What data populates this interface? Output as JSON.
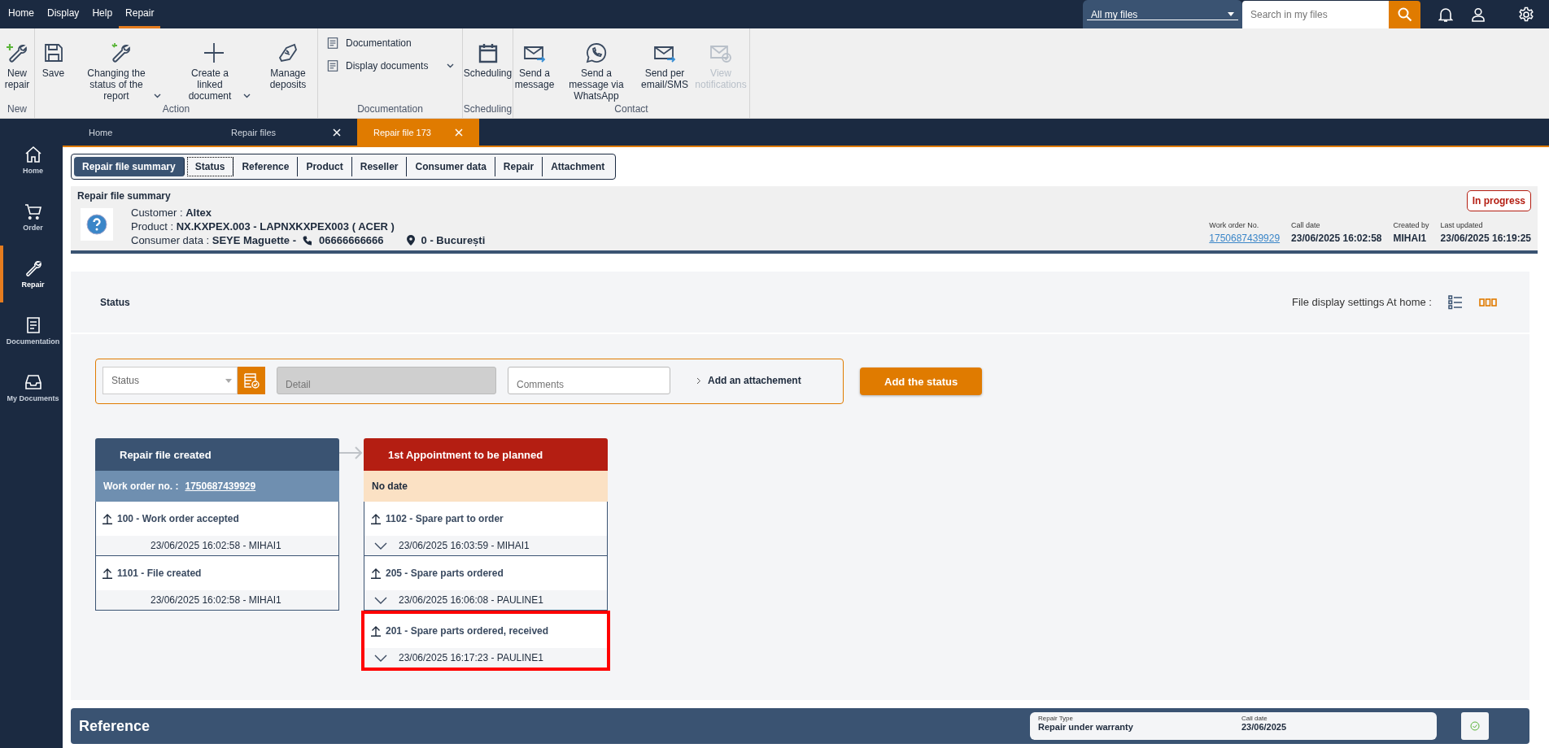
{
  "menu": [
    {
      "label": "Home",
      "selected": false
    },
    {
      "label": "Display",
      "selected": false
    },
    {
      "label": "Help",
      "selected": false
    },
    {
      "label": "Repair",
      "selected": true
    }
  ],
  "scope_select": {
    "value": "All my files"
  },
  "search": {
    "placeholder": "Search in my files"
  },
  "ribbon": [
    {
      "name": "New",
      "items": [
        {
          "label": "New repair",
          "dropdown": false,
          "disabled": false
        }
      ]
    },
    {
      "name": "Action",
      "items": [
        {
          "label": "Save",
          "dropdown": false,
          "disabled": false
        },
        {
          "label": "Changing the status of the report",
          "dropdown": true,
          "disabled": false
        },
        {
          "label": "Create a linked document",
          "dropdown": true,
          "disabled": false
        },
        {
          "label": "Manage deposits",
          "dropdown": false,
          "disabled": false
        }
      ]
    },
    {
      "name": "Documentation",
      "items": [
        {
          "label": "Documentation",
          "dropdown": false,
          "disabled": false
        },
        {
          "label": "Display documents",
          "dropdown": true,
          "disabled": false
        }
      ]
    },
    {
      "name": "Scheduling",
      "items": [
        {
          "label": "Scheduling",
          "dropdown": false,
          "disabled": false
        }
      ]
    },
    {
      "name": "Contact",
      "items": [
        {
          "label": "Send a message",
          "dropdown": false,
          "disabled": false
        },
        {
          "label": "Send a message via WhatsApp",
          "dropdown": false,
          "disabled": false
        },
        {
          "label": "Send per email/SMS",
          "dropdown": false,
          "disabled": false
        },
        {
          "label": "View notifications",
          "dropdown": false,
          "disabled": true
        }
      ]
    }
  ],
  "sidebar": [
    {
      "label": "Home",
      "selected": false
    },
    {
      "label": "Order",
      "selected": false
    },
    {
      "label": "Repair",
      "selected": true
    },
    {
      "label": "Documentation",
      "selected": false
    },
    {
      "label": "My Documents",
      "selected": false
    }
  ],
  "doc_tabs": [
    {
      "label": "Home",
      "closable": false,
      "selected": false
    },
    {
      "label": "Repair files",
      "closable": true,
      "selected": false
    },
    {
      "label": "Repair file 173",
      "closable": true,
      "selected": true
    }
  ],
  "section_tabs": [
    {
      "label": "Repair file summary",
      "selected": true,
      "focused": false
    },
    {
      "label": "Status",
      "selected": false,
      "focused": true
    },
    {
      "label": "Reference",
      "selected": false,
      "focused": false
    },
    {
      "label": "Product",
      "selected": false,
      "focused": false
    },
    {
      "label": "Reseller",
      "selected": false,
      "focused": false
    },
    {
      "label": "Consumer data",
      "selected": false,
      "focused": false
    },
    {
      "label": "Repair",
      "selected": false,
      "focused": false
    },
    {
      "label": "Attachment",
      "selected": false,
      "focused": false
    }
  ],
  "summary": {
    "title": "Repair file summary",
    "customer": "Customer : **Altex**",
    "product": "Product : **NX.KXPEX.003  -  LAPNXKXPEX003 ( ACER )**",
    "consumer": "Consumer data : **SEYE Maguette -**",
    "phone": "06666666666",
    "location": "0  -  București",
    "badge": "In progress",
    "meta": [
      {
        "label": "Work order No.",
        "value": "1750687439929",
        "kind": "link"
      },
      {
        "label": "Call date",
        "value": "23/06/2025 16:02:58",
        "kind": "text"
      },
      {
        "label": "Created by",
        "value": "MIHAI1",
        "kind": "text"
      },
      {
        "label": "Last updated",
        "value": "23/06/2025 16:19:25",
        "kind": "text"
      }
    ]
  },
  "status_panel": {
    "title": "Status",
    "display_settings": "File display settings At home :",
    "views": [
      {
        "selected": false
      },
      {
        "selected": true
      }
    ]
  },
  "form": {
    "status_placeholder": "Status",
    "detail_placeholder": "Detail",
    "comments_placeholder": "Comments",
    "attachment": "Add an attachement",
    "button": "Add the status"
  },
  "timeline": [
    {
      "title": "Repair file created",
      "color": "#3a5372",
      "sub_label": "Work order no. :",
      "sub_value": "1750687439929",
      "entries": [
        {
          "title": "100 - Work order accepted",
          "meta": "23/06/2025 16:02:58  -  MIHAI1",
          "expandable": false,
          "highlighted": false
        },
        {
          "title": "1101 - File created",
          "meta": "23/06/2025 16:02:58  -  MIHAI1",
          "expandable": false,
          "highlighted": false
        }
      ]
    },
    {
      "title": "1st Appointment to be planned",
      "color": "#b41e12",
      "sub_label": "No date",
      "entries": [
        {
          "title": "1102 - Spare part to order",
          "meta": "23/06/2025 16:03:59  -  MIHAI1",
          "expandable": true,
          "highlighted": false
        },
        {
          "title": "205 - Spare parts ordered",
          "meta": "23/06/2025 16:06:08  -  PAULINE1",
          "expandable": true,
          "highlighted": false
        },
        {
          "title": "201 - Spare parts ordered, received",
          "meta": "23/06/2025 16:17:23  -  PAULINE1",
          "expandable": true,
          "highlighted": true
        }
      ]
    }
  ],
  "reference": {
    "title": "Reference",
    "fields": [
      {
        "label": "Repair Type",
        "value": "Repair under warranty"
      },
      {
        "label": "Call date",
        "value": "23/06/2025"
      }
    ]
  }
}
